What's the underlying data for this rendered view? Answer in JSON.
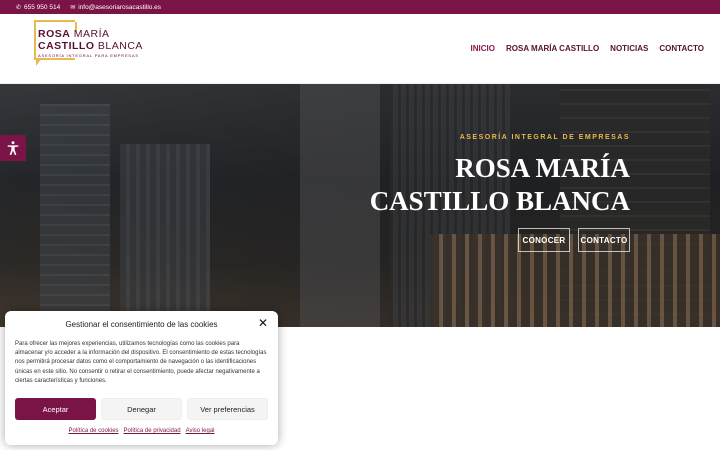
{
  "topbar": {
    "phone": "655 950 514",
    "email": "info@asesoriarosacastillo.es",
    "phone_icon": "phone-icon",
    "email_icon": "envelope-icon",
    "background": "#7a1446"
  },
  "logo": {
    "line1_bold": "ROSA",
    "line1_rest": "MARÍA",
    "line2_bold": "CASTILLO",
    "line2_rest": "BLANCA",
    "tagline": "ASESORÍA INTEGRAL PARA EMPRESAS"
  },
  "nav": {
    "items": [
      "INICIO",
      "ROSA MARÍA CASTILLO",
      "NOTICIAS",
      "CONTACTO"
    ],
    "active": "INICIO"
  },
  "hero": {
    "subtitle": "ASESORÍA INTEGRAL DE EMPRESAS",
    "title_line1": "ROSA MARÍA",
    "title_line2": "CASTILLO BLANCA",
    "btn_conocer": "CONOCER",
    "btn_contacto": "CONTACTO"
  },
  "accessibility": {
    "icon": "accessibility-icon"
  },
  "consent": {
    "title": "Gestionar el consentimiento de las cookies",
    "close_icon": "close-icon",
    "text": "Para ofrecer las mejores experiencias, utilizamos tecnologías como las cookies para almacenar y/o acceder a la información del dispositivo. El consentimiento de estas tecnologías nos permitirá procesar datos como el comportamiento de navegación o las identificaciones únicas en este sitio. No consentir o retirar el consentimiento, puede afectar negativamente a ciertas características y funciones.",
    "accept": "Aceptar",
    "deny": "Denegar",
    "prefs": "Ver preferencias",
    "links": [
      "Política de cookies",
      "Política de privacidad",
      "Aviso legal"
    ]
  },
  "colors": {
    "brand": "#7a1446",
    "accent": "#e9b84f"
  }
}
